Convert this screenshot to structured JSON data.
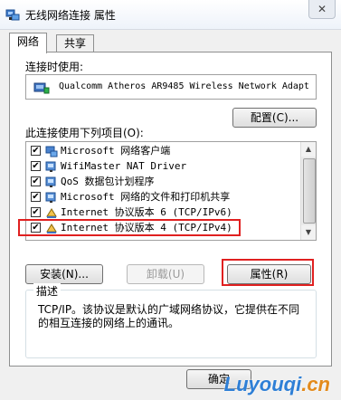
{
  "window": {
    "title": "无线网络连接 属性",
    "close_glyph": "✕"
  },
  "tabs": [
    {
      "label": "网络",
      "active": true
    },
    {
      "label": "共享",
      "active": false
    }
  ],
  "connect_using": {
    "label": "连接时使用:",
    "adapter": "Qualcomm Atheros AR9485 Wireless Network Adapt",
    "configure_label": "配置(C)..."
  },
  "items_section": {
    "label": "此连接使用下列项目(O):",
    "items": [
      {
        "text": "Microsoft 网络客户端",
        "checked": true,
        "icon": "network-client-icon"
      },
      {
        "text": "WifiMaster NAT Driver",
        "checked": true,
        "icon": "network-service-icon"
      },
      {
        "text": "QoS 数据包计划程序",
        "checked": true,
        "icon": "network-service-icon"
      },
      {
        "text": "Microsoft 网络的文件和打印机共享",
        "checked": true,
        "icon": "network-service-icon"
      },
      {
        "text": "Internet 协议版本 6 (TCP/IPv6)",
        "checked": true,
        "icon": "protocol-icon"
      },
      {
        "text": "Internet 协议版本 4 (TCP/IPv4)",
        "checked": true,
        "icon": "protocol-icon"
      }
    ]
  },
  "buttons": {
    "install": "安装(N)...",
    "uninstall": "卸载(U)",
    "properties": "属性(R)",
    "ok": "确定"
  },
  "description": {
    "legend": "描述",
    "text": "TCP/IP。该协议是默认的广域网络协议，它提供在不同的相互连接的网络上的通讯。"
  },
  "watermark": {
    "latin": "Luyouqi",
    "cn": ".cn"
  },
  "colors": {
    "highlight_red": "#e02020",
    "panel_bg": "#ffffff",
    "window_bg": "#f0f0f0"
  }
}
